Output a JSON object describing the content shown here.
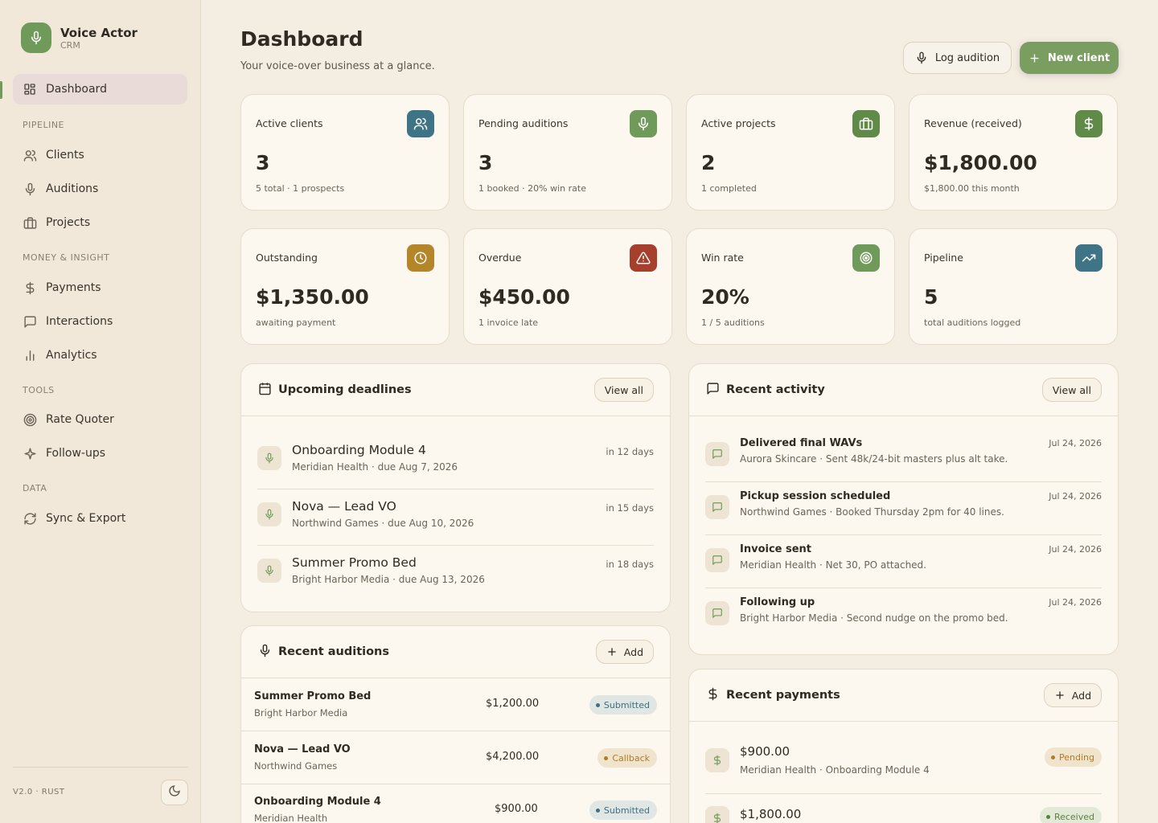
{
  "app": {
    "title": "Voice Actor",
    "subtitle": "CRM",
    "version": "V2.0 · RUST"
  },
  "nav": {
    "dashboard": "Dashboard",
    "section_pipeline": "PIPELINE",
    "clients": "Clients",
    "auditions": "Auditions",
    "projects": "Projects",
    "section_money": "MONEY & INSIGHT",
    "payments": "Payments",
    "interactions": "Interactions",
    "analytics": "Analytics",
    "section_tools": "TOOLS",
    "rate_quoter": "Rate Quoter",
    "follow_ups": "Follow-ups",
    "section_data": "DATA",
    "sync_export": "Sync & Export"
  },
  "header": {
    "title": "Dashboard",
    "subtitle": "Your voice-over business at a glance.",
    "log_audition": "Log audition",
    "new_client": "New client"
  },
  "colors": {
    "accent_green": "#6f9a5a",
    "teal": "#3f7486",
    "amber": "#b5852a",
    "red": "#a63f2c"
  },
  "stats": [
    {
      "label": "Active clients",
      "value": "3",
      "sub": "5 total · 1 prospects",
      "icon": "users-icon"
    },
    {
      "label": "Pending auditions",
      "value": "3",
      "sub": "1 booked · 20% win rate",
      "icon": "mic-icon"
    },
    {
      "label": "Active projects",
      "value": "2",
      "sub": "1 completed",
      "icon": "briefcase-icon"
    },
    {
      "label": "Revenue (received)",
      "value": "$1,800.00",
      "sub": "$1,800.00 this month",
      "icon": "dollar-icon"
    },
    {
      "label": "Outstanding",
      "value": "$1,350.00",
      "sub": "awaiting payment",
      "icon": "clock-icon"
    },
    {
      "label": "Overdue",
      "value": "$450.00",
      "sub": "1 invoice late",
      "icon": "alert-icon"
    },
    {
      "label": "Win rate",
      "value": "20%",
      "sub": "1 / 5 auditions",
      "icon": "target-icon"
    },
    {
      "label": "Pipeline",
      "value": "5",
      "sub": "total auditions logged",
      "icon": "trending-up-icon"
    }
  ],
  "deadlines": {
    "title": "Upcoming deadlines",
    "view_all": "View all",
    "items": [
      {
        "title": "Onboarding Module 4",
        "sub": "Meridian Health · due Aug 7, 2026",
        "when": "in 12 days"
      },
      {
        "title": "Nova — Lead VO",
        "sub": "Northwind Games · due Aug 10, 2026",
        "when": "in 15 days"
      },
      {
        "title": "Summer Promo Bed",
        "sub": "Bright Harbor Media · due Aug 13, 2026",
        "when": "in 18 days"
      }
    ]
  },
  "activity": {
    "title": "Recent activity",
    "view_all": "View all",
    "items": [
      {
        "title": "Delivered final WAVs",
        "sub": "Aurora Skincare · Sent 48k/24-bit masters plus alt take.",
        "date": "Jul 24, 2026"
      },
      {
        "title": "Pickup session scheduled",
        "sub": "Northwind Games · Booked Thursday 2pm for 40 lines.",
        "date": "Jul 24, 2026"
      },
      {
        "title": "Invoice sent",
        "sub": "Meridian Health · Net 30, PO attached.",
        "date": "Jul 24, 2026"
      },
      {
        "title": "Following up",
        "sub": "Bright Harbor Media · Second nudge on the promo bed.",
        "date": "Jul 24, 2026"
      }
    ]
  },
  "auditions": {
    "title": "Recent auditions",
    "add": "Add",
    "items": [
      {
        "title": "Summer Promo Bed",
        "client": "Bright Harbor Media",
        "amount": "$1,200.00",
        "status": "Submitted"
      },
      {
        "title": "Nova — Lead VO",
        "client": "Northwind Games",
        "amount": "$4,200.00",
        "status": "Callback"
      },
      {
        "title": "Onboarding Module 4",
        "client": "Meridian Health",
        "amount": "$900.00",
        "status": "Submitted"
      }
    ]
  },
  "payments": {
    "title": "Recent payments",
    "add": "Add",
    "items": [
      {
        "amount": "$900.00",
        "sub": "Meridian Health · Onboarding Module 4",
        "status": "Pending"
      },
      {
        "amount": "$1,800.00",
        "sub": "",
        "status": "Received"
      }
    ]
  }
}
